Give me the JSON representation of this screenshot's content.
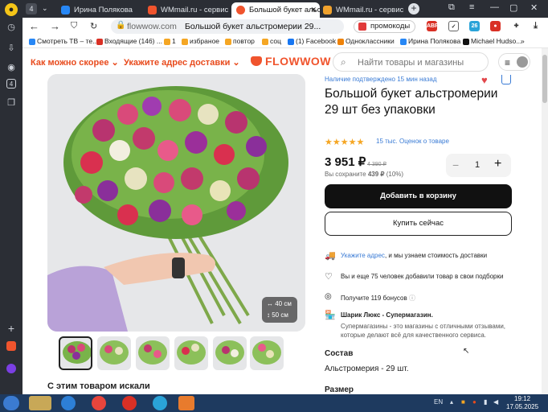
{
  "tabs": [
    {
      "label": "Ирина Полякова",
      "active": false,
      "icon_color": "#2787f5"
    },
    {
      "label": "WMmail.ru - сервис по",
      "active": false,
      "icon_color": "#f0542d"
    },
    {
      "label": "Большой букет альс",
      "active": true,
      "icon_color": "#f0542d"
    },
    {
      "label": "WMmail.ru - сервис по",
      "active": false,
      "icon_color": "#f0a22d"
    }
  ],
  "tab_counter": "4",
  "address": {
    "host": "flowwow.com",
    "title": "Большой букет альстромерии 29...",
    "promo_label": "промокоды"
  },
  "bookmarks": [
    {
      "label": "Смотреть ТВ – те...",
      "color": "#2787f5"
    },
    {
      "label": "Входящие (146) ...",
      "color": "#d93025"
    },
    {
      "label": "1",
      "color": "#f5a623"
    },
    {
      "label": "избраное",
      "color": "#f5a623"
    },
    {
      "label": "повтор",
      "color": "#f5a623"
    },
    {
      "label": "соц",
      "color": "#f5a623"
    },
    {
      "label": "(1) Facebook",
      "color": "#1877f2"
    },
    {
      "label": "Одноклассники",
      "color": "#ee8208"
    },
    {
      "label": "Ирина Полякова",
      "color": "#2787f5"
    },
    {
      "label": "Michael Hudso...",
      "color": "#111111"
    }
  ],
  "site": {
    "delivery_fast": "Как можно скорее",
    "delivery_address": "Укажите адрес доставки",
    "logo": "FLOWWOW",
    "search_placeholder": "Найти товары и магазины"
  },
  "product": {
    "availability": "Наличие подтверждено 15 мин назад",
    "title": "Большой букет альстромерии 29 шт без упаковки",
    "rating_stars": 5,
    "reviews": "15 тыс. Оценок о товаре",
    "price": "3 951 ₽",
    "old_price": "4 390 ₽",
    "savings_prefix": "Вы сохраните",
    "savings_amount": "439 ₽",
    "savings_percent": "(10%)",
    "quantity": "1",
    "add_to_cart": "Добавить в корзину",
    "buy_now": "Купить сейчас",
    "size_width": "40 см",
    "size_height": "50 см"
  },
  "features": {
    "delivery_link": "Укажите адрес",
    "delivery_text": ", и мы узнаем стоимость доставки",
    "wishlist_text": "Вы и еще 75 человек добавили товар в свои подборки",
    "bonus_text": "Получите 119 бонусов",
    "shop_name": "Шарик Люкс - Супермагазин.",
    "shop_desc": "Супермагазины - это магазины с отличными отзывами, которые делают всё для качественного сервиса."
  },
  "composition": {
    "heading": "Состав",
    "value": "Альстромерия - 29 шт."
  },
  "size_heading": "Размер",
  "also_searched": "С этим товаром искали",
  "taskbar": {
    "lang": "EN",
    "time": "19:12",
    "date": "17.05.2025"
  },
  "colors": {
    "accent": "#f0542d",
    "link": "#3a7bd5",
    "dark_button": "#111111"
  }
}
